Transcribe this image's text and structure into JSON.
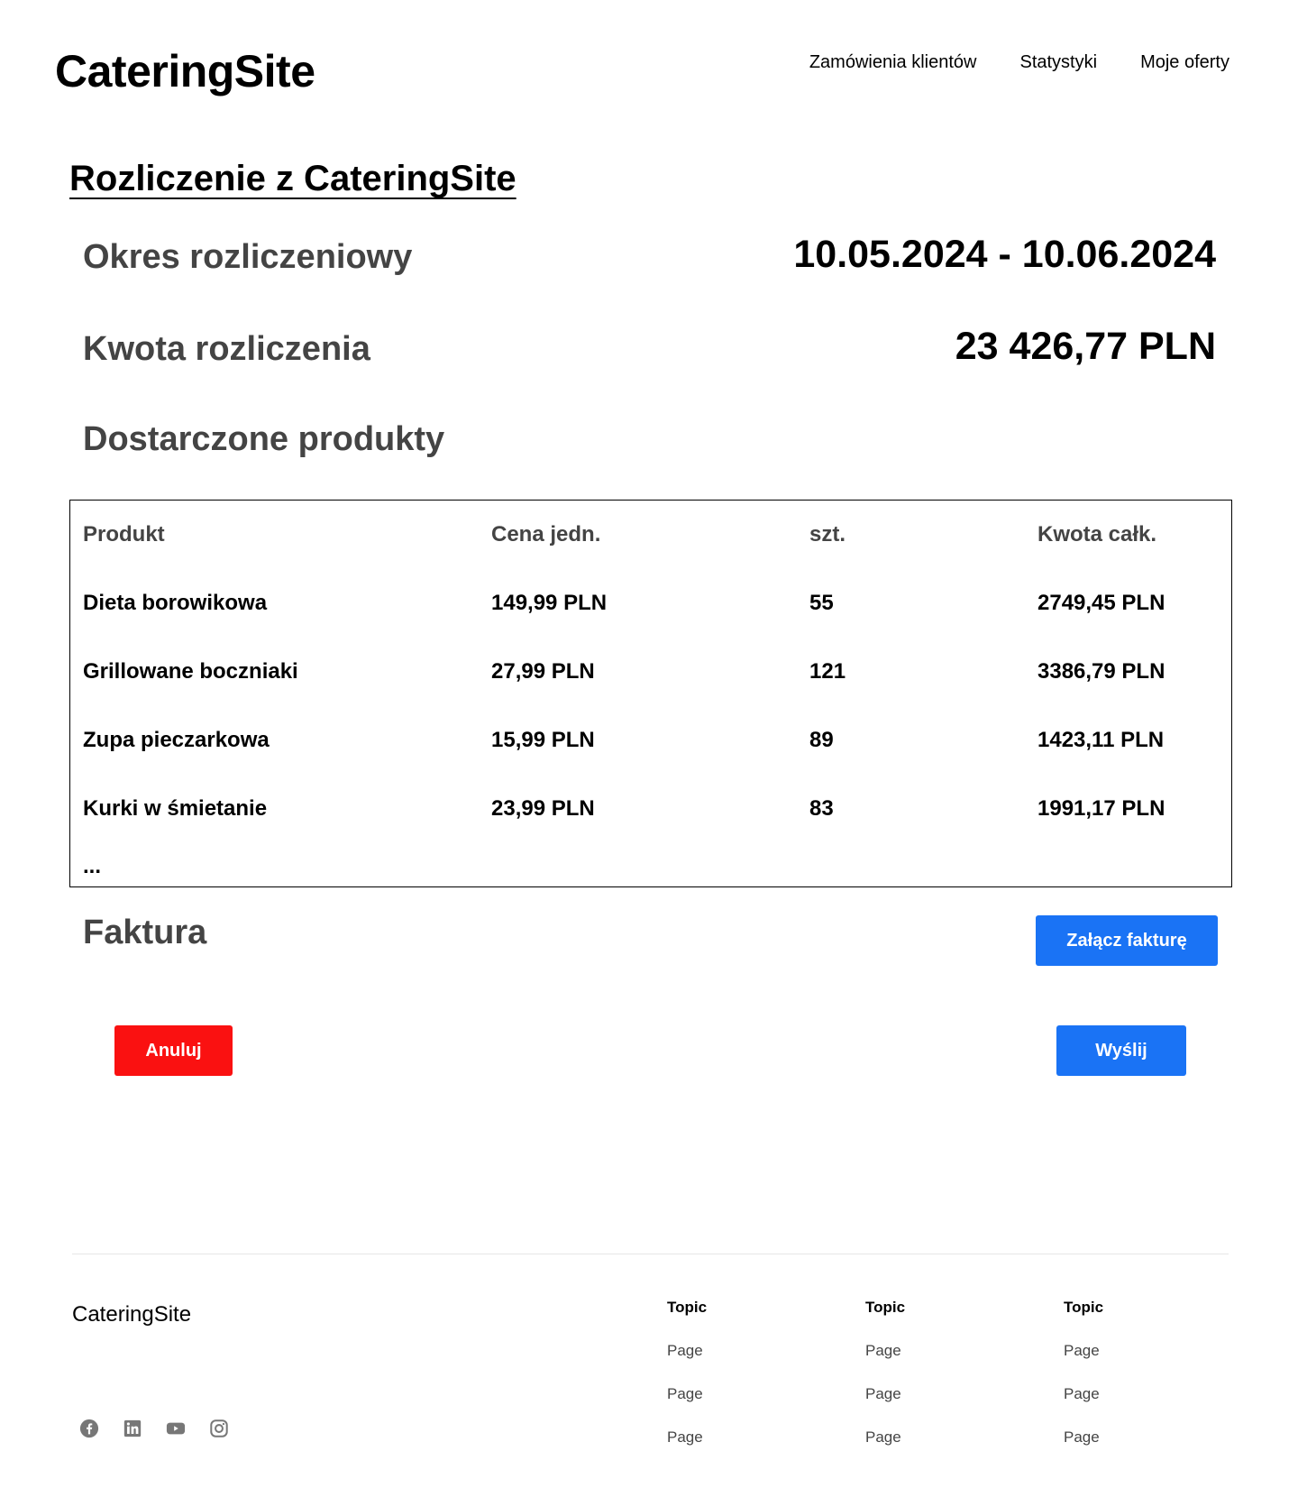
{
  "header": {
    "logo": "CateringSite",
    "nav": [
      "Zamówienia klientów",
      "Statystyki",
      "Moje oferty"
    ]
  },
  "page": {
    "title": "Rozliczenie z CateringSite",
    "period_label": "Okres rozliczeniowy",
    "period_value": "10.05.2024 - 10.06.2024",
    "amount_label": "Kwota rozliczenia",
    "amount_value": "23 426,77 PLN",
    "products_label": "Dostarczone produkty"
  },
  "table": {
    "headers": [
      "Produkt",
      "Cena jedn.",
      "szt.",
      "Kwota całk."
    ],
    "rows": [
      [
        "Dieta borowikowa",
        "149,99 PLN",
        "55",
        "2749,45 PLN"
      ],
      [
        "Grillowane boczniaki",
        "27,99 PLN",
        "121",
        "3386,79 PLN"
      ],
      [
        "Zupa pieczarkowa",
        "15,99 PLN",
        "89",
        "1423,11 PLN"
      ],
      [
        "Kurki w śmietanie",
        "23,99 PLN",
        "83",
        "1991,17 PLN"
      ]
    ],
    "more": "..."
  },
  "invoice": {
    "label": "Faktura",
    "attach_button": "Załącz fakturę"
  },
  "actions": {
    "cancel": "Anuluj",
    "send": "Wyślij"
  },
  "footer": {
    "brand": "CateringSite",
    "columns": [
      {
        "topic": "Topic",
        "links": [
          "Page",
          "Page",
          "Page"
        ]
      },
      {
        "topic": "Topic",
        "links": [
          "Page",
          "Page",
          "Page"
        ]
      },
      {
        "topic": "Topic",
        "links": [
          "Page",
          "Page",
          "Page"
        ]
      }
    ],
    "socials": [
      "facebook-icon",
      "linkedin-icon",
      "youtube-icon",
      "instagram-icon"
    ]
  },
  "colors": {
    "primary_button": "#1a73f5",
    "danger_button": "#fa1111",
    "label_gray": "#444444"
  }
}
